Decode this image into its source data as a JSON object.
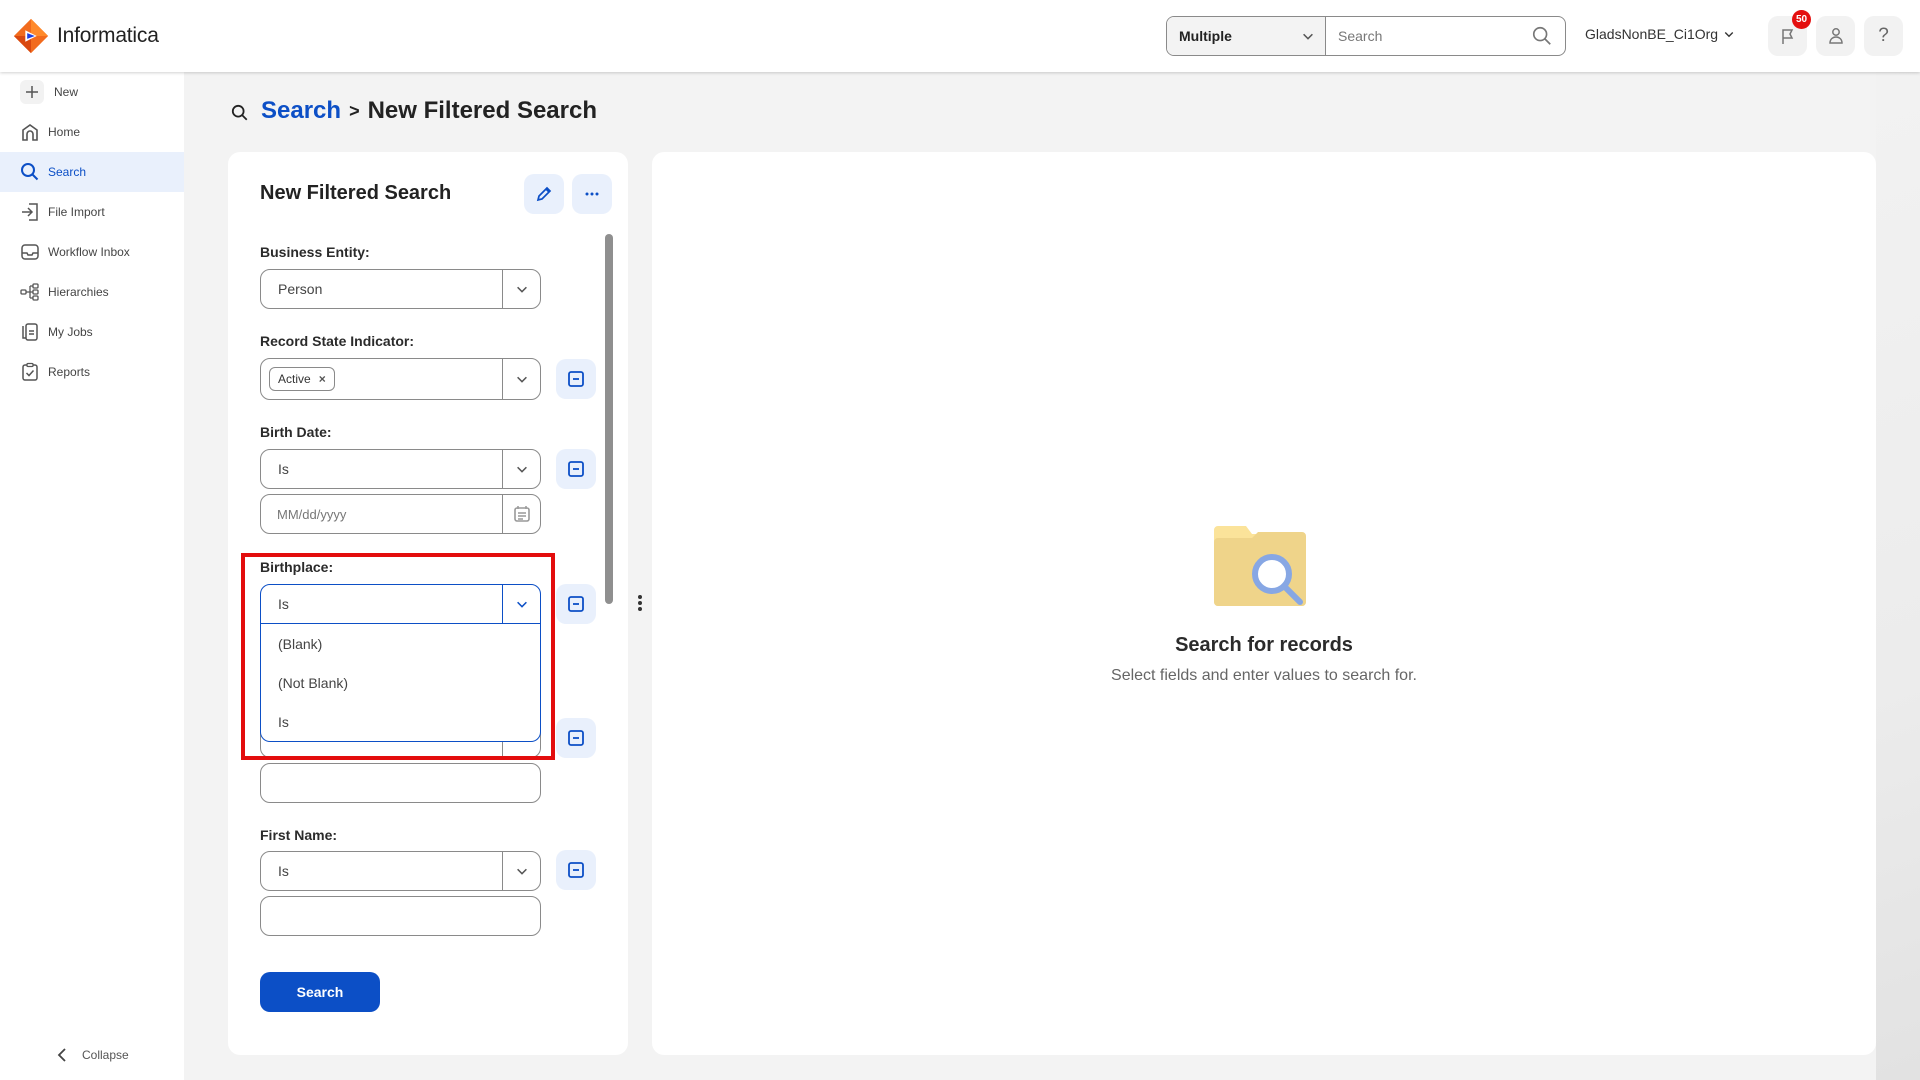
{
  "header": {
    "brand": "Informatica",
    "scope_select": "Multiple",
    "search_placeholder": "Search",
    "org_name": "GladsNonBE_Ci1Org",
    "notification_count": "50",
    "icons": [
      "flag-icon",
      "user-icon",
      "help-icon"
    ]
  },
  "sidebar": {
    "items": [
      {
        "label": "New",
        "icon": "plus-icon"
      },
      {
        "label": "Home",
        "icon": "home-icon"
      },
      {
        "label": "Search",
        "icon": "search-icon",
        "active": true
      },
      {
        "label": "File Import",
        "icon": "file-import-icon"
      },
      {
        "label": "Workflow Inbox",
        "icon": "inbox-icon"
      },
      {
        "label": "Hierarchies",
        "icon": "hierarchy-icon"
      },
      {
        "label": "My Jobs",
        "icon": "jobs-icon"
      },
      {
        "label": "Reports",
        "icon": "reports-icon"
      }
    ],
    "collapse_label": "Collapse"
  },
  "breadcrumb": {
    "root": "Search",
    "separator": ">",
    "current": "New Filtered Search"
  },
  "filter_panel": {
    "title": "New Filtered Search",
    "fields": {
      "business_entity": {
        "label": "Business Entity:",
        "value": "Person"
      },
      "record_state": {
        "label": "Record State Indicator:",
        "chips": [
          "Active"
        ],
        "chip_remove": "×"
      },
      "birth_date": {
        "label": "Birth Date:",
        "operator": "Is",
        "date_placeholder": "MM/dd/yyyy"
      },
      "birthplace": {
        "label": "Birthplace:",
        "operator": "Is",
        "dropdown_open": true,
        "options": [
          "(Blank)",
          "(Not Blank)",
          "Is"
        ]
      },
      "first_name": {
        "label": "First Name:",
        "operator": "Is",
        "value": ""
      }
    },
    "search_button": "Search"
  },
  "results": {
    "empty_title": "Search for records",
    "empty_subtitle": "Select fields and enter values to search for."
  },
  "colors": {
    "accent": "#0c4fc6",
    "highlight": "#e30d0d",
    "badge": "#e40f0f"
  }
}
